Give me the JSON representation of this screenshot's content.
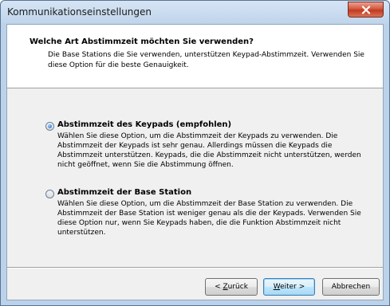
{
  "window": {
    "title": "Kommunikationseinstellungen"
  },
  "header": {
    "title": "Welche Art Abstimmzeit möchten Sie verwenden?",
    "description": "Die Base Stations die Sie verwenden, unterstützen Keypad-Abstimmzeit. Verwenden Sie diese Option für die beste Genauigkeit."
  },
  "options": [
    {
      "label": "Abstimmzeit des Keypads (empfohlen)",
      "description": "Wählen Sie diese Option, um die Abstimmzeit der Keypads zu verwenden. Die Abstimmzeit der Keypads ist sehr genau. Allerdings müssen die Keypads die Abstimmzeit unterstützen. Keypads, die die Abstimmzeit nicht unterstützen, werden nicht geöffnet, wenn Sie die Abstimmung öffnen.",
      "selected": true
    },
    {
      "label": "Abstimmzeit der Base Station",
      "description": "Wählen Sie diese Option, um die Abstimmzeit der Base Station zu verwenden. Die Abstimmzeit der Base Station ist weniger genau als die der Keypads. Verwenden Sie diese Option nur, wenn Sie Keypads haben, die die Funktion Abstimmzeit nicht unterstützen.",
      "selected": false
    }
  ],
  "buttons": {
    "back_prefix": "< ",
    "back_accel": "Z",
    "back_rest": "urück",
    "next_accel": "W",
    "next_rest": "eiter >",
    "cancel": "Abbrechen"
  },
  "colors": {
    "title_bar": "#bed3ea",
    "close_button": "#c23a1f",
    "radio_selected": "#1f5fb5",
    "default_button_border": "#3c7fb1"
  },
  "icons": {
    "close": "close-icon"
  }
}
